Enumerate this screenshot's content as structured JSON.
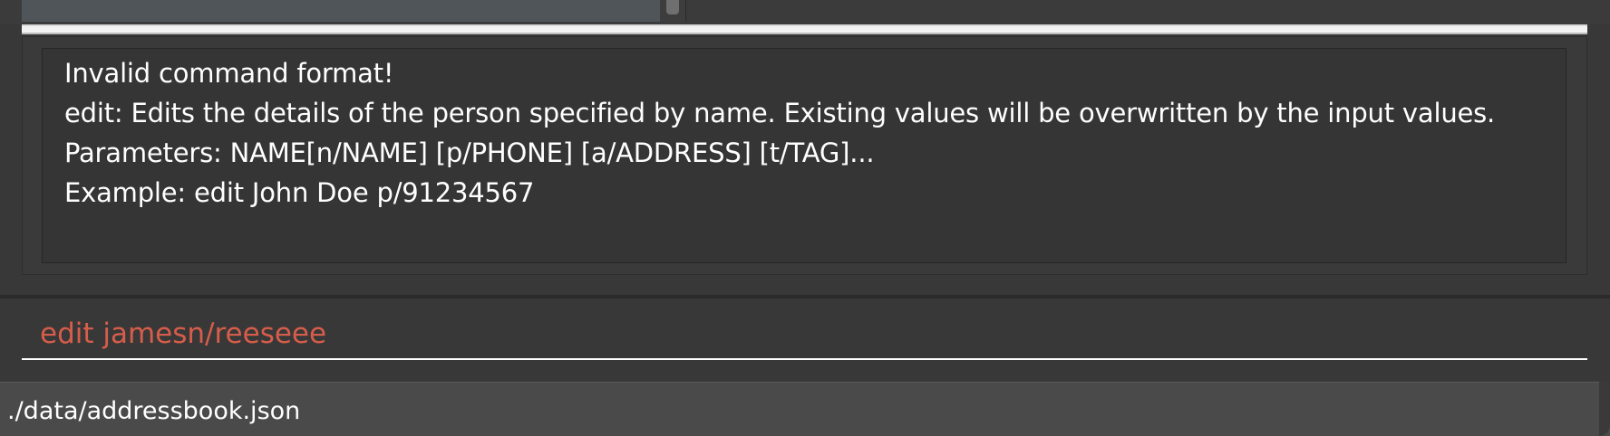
{
  "result": {
    "lines": [
      "Invalid command format!",
      "edit: Edits the details of the person specified by name. Existing values will be overwritten by the input values.",
      "Parameters: NAME[n/NAME] [p/PHONE] [a/ADDRESS] [t/TAG]...",
      "Example: edit John Doe p/91234567"
    ]
  },
  "command_box": {
    "value": "edit jamesn/reeseee",
    "text_color": "#d65d4a"
  },
  "status_bar": {
    "file_path": "./data/addressbook.json"
  },
  "colors": {
    "background": "#383838",
    "list_panel": "#4f5559",
    "text": "#ffffff"
  }
}
